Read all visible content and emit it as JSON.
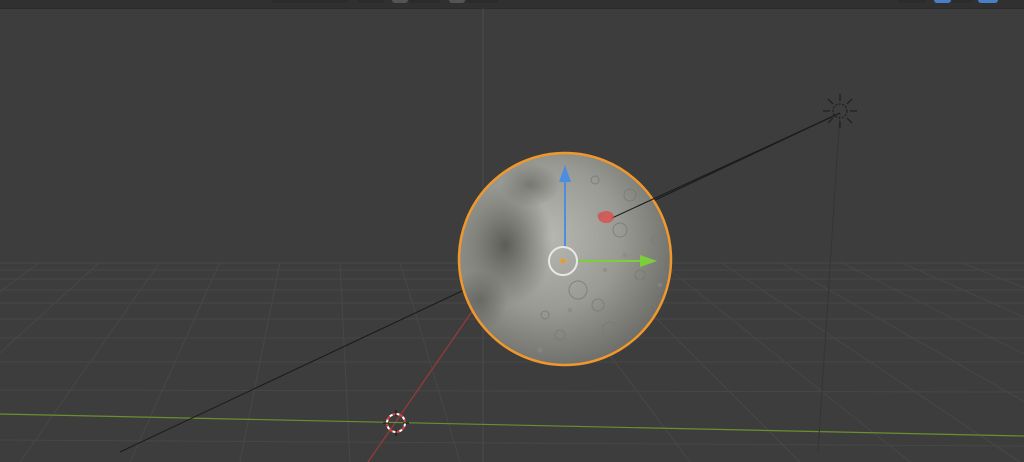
{
  "app": "3D viewport",
  "header": {
    "buttons": [
      {
        "name": "shading-dropdown",
        "style": "dark"
      },
      {
        "name": "overlay-toggle",
        "style": "dark"
      },
      {
        "name": "gizmo-toggle",
        "style": "grey"
      },
      {
        "name": "gizmo-dropdown",
        "style": "dark"
      },
      {
        "name": "xray-toggle",
        "style": "grey"
      },
      {
        "name": "xray-dropdown",
        "style": "dark"
      },
      {
        "name": "wireframe-shading",
        "style": "dark"
      },
      {
        "name": "solid-shading",
        "style": "blue"
      },
      {
        "name": "material-shading",
        "style": "dark"
      },
      {
        "name": "rendered-shading",
        "style": "blue"
      }
    ]
  },
  "colors": {
    "background": "#3d3d3d",
    "grid": "#474747",
    "x_axis": "#9a3a3a",
    "y_axis": "#6a8f2e",
    "selection_outline": "#f0982c",
    "gizmo_z": "#4d8de0",
    "gizmo_y": "#7bcf3a",
    "gizmo_x": "#e04848"
  },
  "scene": {
    "objects": [
      {
        "name": "moon-sphere",
        "type": "mesh",
        "selected": true
      },
      {
        "name": "sun-light",
        "type": "light"
      },
      {
        "name": "3d-cursor",
        "type": "cursor"
      }
    ]
  }
}
